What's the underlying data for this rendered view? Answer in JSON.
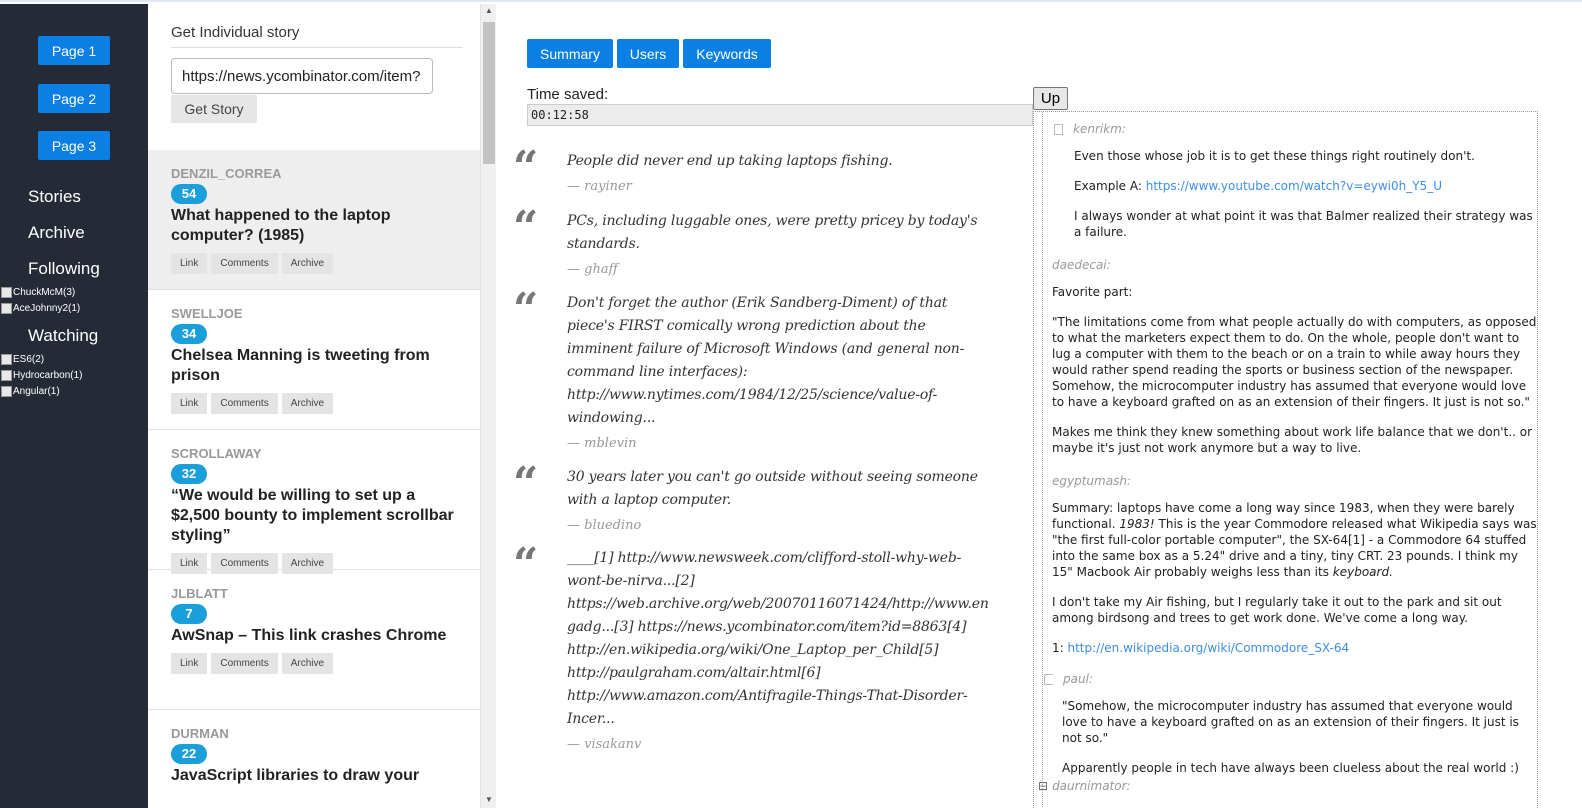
{
  "nav": {
    "pages": [
      "Page 1",
      "Page 2",
      "Page 3"
    ],
    "stories": "Stories",
    "archive": "Archive",
    "following": "Following",
    "following_items": [
      "ChuckMcM(3)",
      "AceJohnny2(1)"
    ],
    "watching": "Watching",
    "watching_items": [
      "ES6(2)",
      "Hydrocarbon(1)",
      "Angular(1)"
    ]
  },
  "story_panel": {
    "title": "Get Individual story",
    "url_value": "https://news.ycombinator.com/item?",
    "get_button": "Get Story",
    "actions": [
      "Link",
      "Comments",
      "Archive"
    ],
    "stories": [
      {
        "author": "DENZIL_CORREA",
        "score": "54",
        "title": "What happened to the laptop computer? (1985)"
      },
      {
        "author": "SWELLJOE",
        "score": "34",
        "title": "Chelsea Manning is tweeting from prison"
      },
      {
        "author": "SCROLLAWAY",
        "score": "32",
        "title": "“We would be willing to set up a $2,500 bounty to implement scrollbar styling”"
      },
      {
        "author": "JLBLATT",
        "score": "7",
        "title": "AwSnap – This link crashes Chrome"
      },
      {
        "author": "DURMAN",
        "score": "22",
        "title": "JavaScript libraries to draw your"
      }
    ]
  },
  "tabs": [
    "Summary",
    "Users",
    "Keywords"
  ],
  "time_saved": {
    "label": "Time saved:",
    "value": "00:12:58"
  },
  "quotes": [
    {
      "text": "People did never end up taking laptops fishing.",
      "author": "— rayiner"
    },
    {
      "text": "PCs, including luggable ones, were pretty pricey by today's standards.",
      "author": "— ghaff"
    },
    {
      "text": "Don't forget the author (Erik Sandberg-Diment) of that piece's FIRST comically wrong prediction about the imminent failure of Microsoft Windows (and general non-command line interfaces): http://www.nytimes.com/1984/12/25/science/value-of-windowing...",
      "author": "— mblevin"
    },
    {
      "text": "30 years later you can't go outside without seeing someone with a laptop computer.",
      "author": "— bluedino"
    },
    {
      "text": "____[1] http://www.newsweek.com/clifford-stoll-why-web-wont-be-nirva...[2] https://web.archive.org/web/20070116071424/http://www.engadg...[3] https://news.ycombinator.com/item?id=8863[4] http://en.wikipedia.org/wiki/One_Laptop_per_Child[5] http://paulgraham.com/altair.html[6] http://www.amazon.com/Antifragile-Things-That-Disorder-Incer...",
      "author": "— visakanv"
    }
  ],
  "up_button": "Up",
  "comments": [
    {
      "user": "kenrikm:",
      "p1": "Even those whose job it is to get these things right routinely don't.",
      "p2_prefix": "Example A: ",
      "p2_link": "https://www.youtube.com/watch?v=eywi0h_Y5_U",
      "p3": "I always wonder at what point it was that Balmer realized their strategy was a failure."
    },
    {
      "user": "daedecai:",
      "p1": "Favorite part:",
      "p2": "\"The limitations come from what people actually do with computers, as opposed to what the marketers expect them to do. On the whole, people don't want to lug a computer with them to the beach or on a train to while away hours they would rather spend reading the sports or business section of the newspaper. Somehow, the microcomputer industry has assumed that everyone would love to have a keyboard grafted on as an extension of their fingers. It just is not so.\"",
      "p3": "Makes me think they knew something about work life balance that we don't.. or maybe it's just not work anymore but a way to live."
    },
    {
      "user": "egyptumash:",
      "p1a": "Summary: laptops have come a long way since 1983, when they were barely functional. ",
      "p1em": "1983!",
      "p1b": " This is the year Commodore released what Wikipedia says was \"the first full-color portable computer\", the SX-64[1] - a Commodore 64 stuffed into the same box as a 5.24\" drive and a tiny, tiny CRT. 23 pounds. I think my 15\" Macbook Air probably weighs less than its ",
      "p1em2": "keyboard.",
      "p2": "I don't take my Air fishing, but I regularly take it out to the park and sit out among birdsong and trees to get work done. We've come a long way.",
      "p3_prefix": "1: ",
      "p3_link": "http://en.wikipedia.org/wiki/Commodore_SX-64"
    },
    {
      "user": "paul:",
      "p1": "\"Somehow, the microcomputer industry has assumed that everyone would love to have a keyboard grafted on as an extension of their fingers. It just is not so.\"",
      "p2": "Apparently people in tech have always been clueless about the real world :)"
    },
    {
      "user": "daurnimator:"
    }
  ],
  "colors": {
    "nav_bg": "#252a37",
    "accent": "#0b7fe3",
    "score_badge": "#1a9fdb",
    "link": "#3c8fe6"
  }
}
